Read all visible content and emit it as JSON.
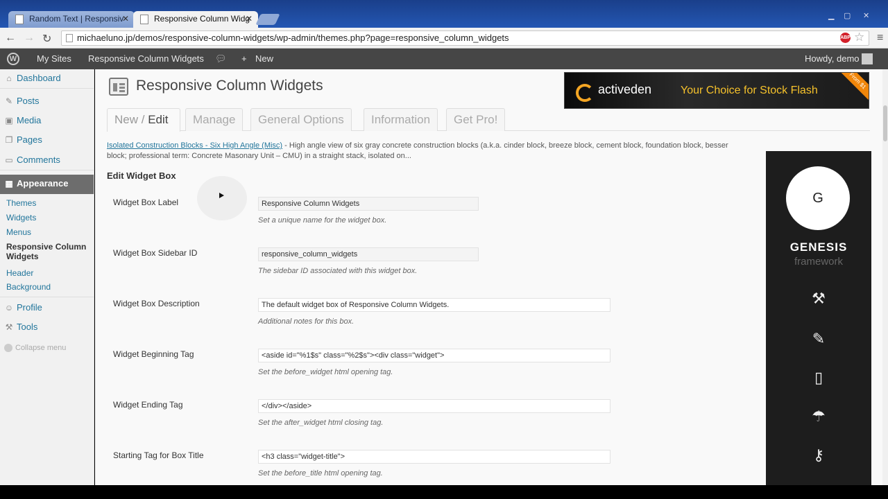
{
  "browser": {
    "tabs": [
      {
        "title": "Random Text | Responsiv",
        "active": false
      },
      {
        "title": "Responsive Column Widg",
        "active": true
      }
    ],
    "url": "michaeluno.jp/demos/responsive-column-widgets/wp-admin/themes.php?page=responsive_column_widgets",
    "abp_label": "ABP"
  },
  "adminbar": {
    "my_sites": "My Sites",
    "site_name": "Responsive Column Widgets",
    "new_label": "New",
    "howdy": "Howdy, demo"
  },
  "sidebar": {
    "dashboard": "Dashboard",
    "posts": "Posts",
    "media": "Media",
    "pages": "Pages",
    "comments": "Comments",
    "appearance": "Appearance",
    "sub": {
      "themes": "Themes",
      "widgets": "Widgets",
      "menus": "Menus",
      "rcw_line1": "Responsive Column",
      "rcw_line2": "Widgets",
      "header": "Header",
      "background": "Background"
    },
    "profile": "Profile",
    "tools": "Tools",
    "collapse": "Collapse menu"
  },
  "page": {
    "title": "Responsive Column Widgets",
    "tabs": {
      "new": "New",
      "sep": "/",
      "edit": "Edit",
      "manage": "Manage",
      "general": "General Options",
      "information": "Information",
      "getpro": "Get Pro!"
    },
    "post_link": "Isolated Construction Blocks - Six High Angle (Misc)",
    "post_excerpt": " - High angle view of six gray concrete construction blocks (a.k.a. cinder block, breeze block, cement block, foundation block, besser block; professional term: Concrete Masonary Unit – CMU) in a straight stack, isolated on...",
    "section": "Edit Widget Box",
    "rows": [
      {
        "label": "Widget Box Label",
        "value": "Responsive Column Widgets",
        "hint": "Set a unique name for the widget box."
      },
      {
        "label": "Widget Box Sidebar ID",
        "value": "responsive_column_widgets",
        "hint": "The sidebar ID associated with this widget box."
      },
      {
        "label": "Widget Box Description",
        "value": "The default widget box of Responsive Column Widgets.",
        "hint": "Additional notes for this box."
      },
      {
        "label": "Widget Beginning Tag",
        "value": "<aside id=\"%1$s\" class=\"%2$s\"><div class=\"widget\">",
        "hint": "Set the before_widget html opening tag."
      },
      {
        "label": "Widget Ending Tag",
        "value": "</div></aside>",
        "hint": "Set the after_widget html closing tag."
      },
      {
        "label": "Starting Tag for Box Title",
        "value": "<h3 class=\"widget-title\">",
        "hint": "Set the before_title html opening tag."
      }
    ]
  },
  "ads": {
    "activeden_brand": "activeden",
    "activeden_tag": "Your Choice for Stock Flash",
    "activeden_corner": "From $1",
    "genesis_letter": "G",
    "genesis_title": "GENESIS",
    "genesis_sub": "framework"
  },
  "colors": {
    "link": "#21759b",
    "adminbar": "#464646",
    "appearance_bg": "#6d6d6d",
    "genesis_bg": "#1d1d1d",
    "activeden_accent": "#f6c22b"
  }
}
